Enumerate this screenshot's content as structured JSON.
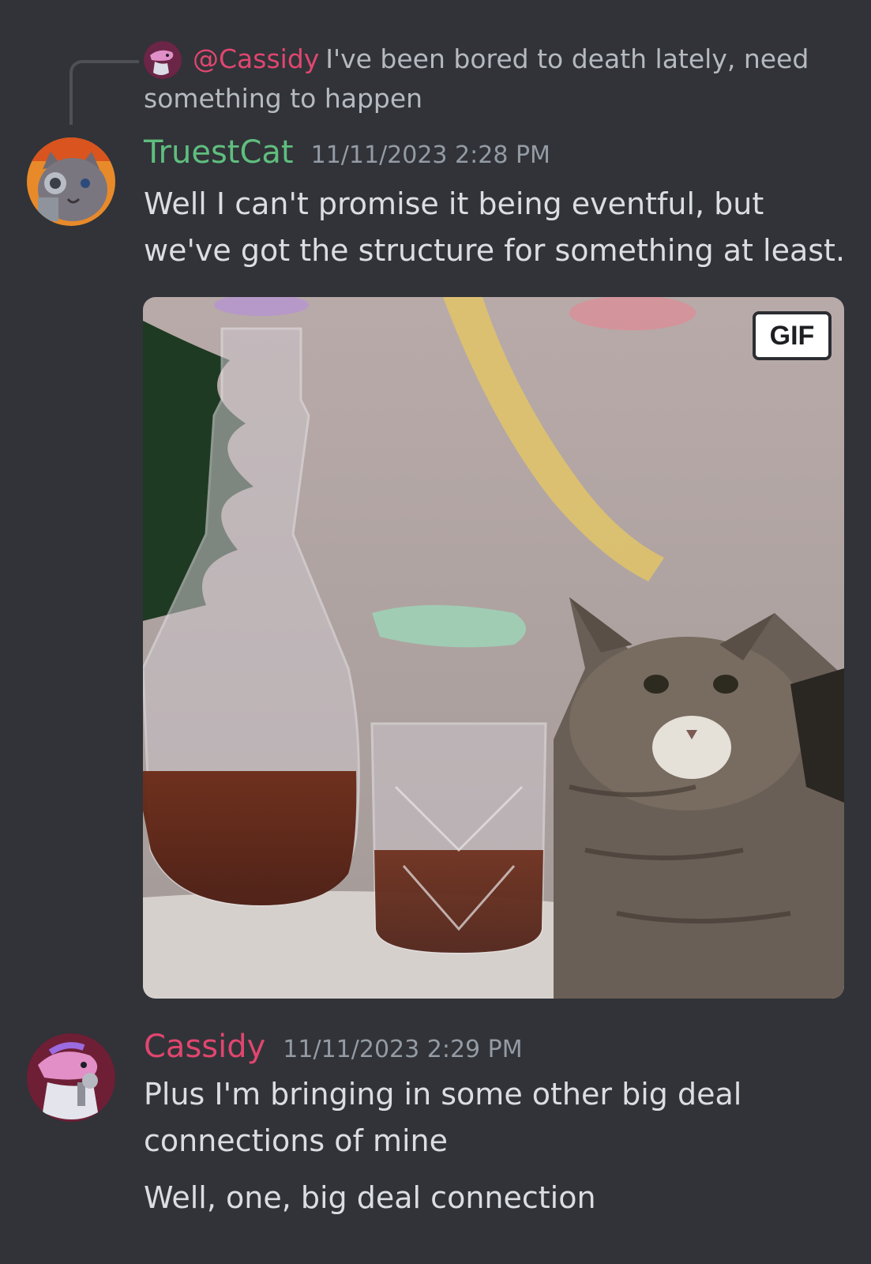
{
  "reply": {
    "author": "@Cassidy",
    "text": "I've been bored to death lately, need something to happen"
  },
  "messages": [
    {
      "author": "TruestCat",
      "timestamp": "11/11/2023 2:28 PM",
      "text": "Well I can't promise it being eventful, but we've got the structure for something at least.",
      "attachment_badge": "GIF"
    },
    {
      "author": "Cassidy",
      "timestamp": "11/11/2023 2:29 PM",
      "lines": [
        "Plus I'm bringing in some other big deal connections of mine",
        "Well, one, big deal connection"
      ]
    }
  ],
  "colors": {
    "background": "#313338",
    "truestcat_name": "#5fbe7e",
    "cassidy_name": "#e0466f",
    "message_text": "#dbdee1",
    "timestamp": "#949ba4"
  }
}
